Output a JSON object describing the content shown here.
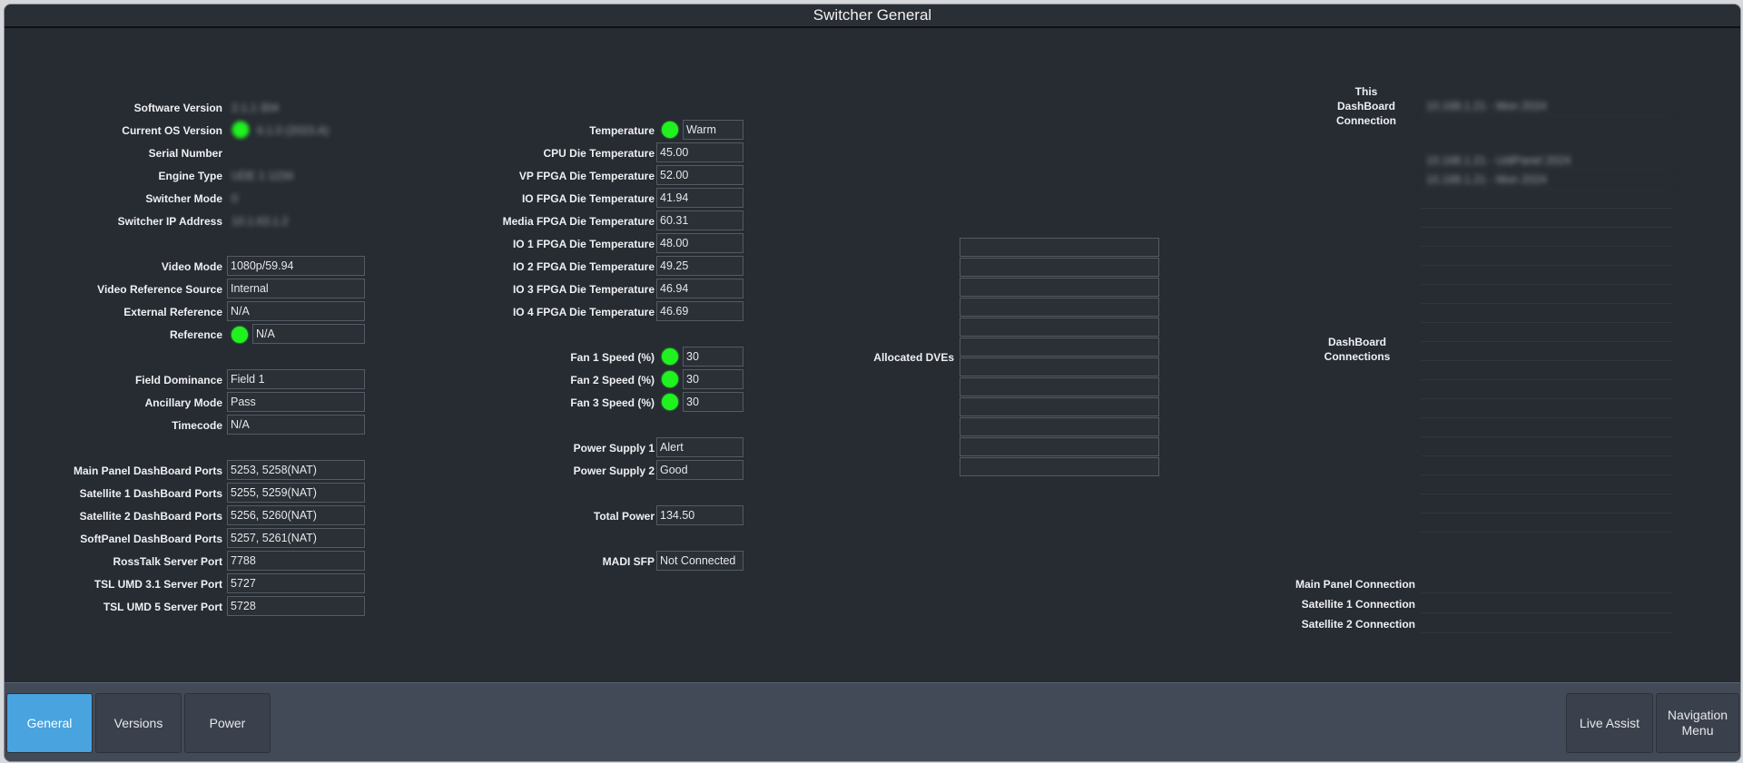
{
  "window": {
    "title": "Switcher General"
  },
  "left": {
    "software_version_label": "Software Version",
    "software_version": "2.1.1 304",
    "current_os_label": "Current OS Version",
    "current_os": "6.1.0 (2023.A)",
    "serial_number_label": "Serial Number",
    "engine_type_label": "Engine Type",
    "engine_type": "UDE 1 1234",
    "switcher_mode_label": "Switcher Mode",
    "switcher_mode": "0",
    "switcher_ip_label": "Switcher IP Address",
    "switcher_ip": "10.1.63.1.2",
    "video_mode_label": "Video Mode",
    "video_mode": "1080p/59.94",
    "video_ref_source_label": "Video Reference Source",
    "video_ref_source": "Internal",
    "external_ref_label": "External Reference",
    "external_ref": "N/A",
    "reference_label": "Reference",
    "reference": "N/A",
    "field_dominance_label": "Field Dominance",
    "field_dominance": "Field 1",
    "ancillary_mode_label": "Ancillary Mode",
    "ancillary_mode": "Pass",
    "timecode_label": "Timecode",
    "timecode": "N/A",
    "main_panel_ports_label": "Main Panel DashBoard Ports",
    "main_panel_ports": "5253, 5258(NAT)",
    "sat1_ports_label": "Satellite 1 DashBoard Ports",
    "sat1_ports": "5255, 5259(NAT)",
    "sat2_ports_label": "Satellite 2 DashBoard Ports",
    "sat2_ports": "5256, 5260(NAT)",
    "softpanel_ports_label": "SoftPanel DashBoard Ports",
    "softpanel_ports": "5257, 5261(NAT)",
    "rosstalk_label": "RossTalk Server Port",
    "rosstalk": "7788",
    "tsl31_label": "TSL UMD 3.1 Server Port",
    "tsl31": "5727",
    "tsl5_label": "TSL UMD 5 Server Port",
    "tsl5": "5728"
  },
  "middle": {
    "temperature_label": "Temperature",
    "temperature": "Warm",
    "cpu_label": "CPU Die Temperature",
    "cpu": "45.00",
    "vp_label": "VP FPGA Die Temperature",
    "vp": "52.00",
    "io_label": "IO FPGA Die Temperature",
    "io": "41.94",
    "media_label": "Media FPGA Die Temperature",
    "media": "60.31",
    "io1_label": "IO 1 FPGA Die Temperature",
    "io1": "48.00",
    "io2_label": "IO 2 FPGA Die Temperature",
    "io2": "49.25",
    "io3_label": "IO 3 FPGA Die Temperature",
    "io3": "46.94",
    "io4_label": "IO 4 FPGA Die Temperature",
    "io4": "46.69",
    "fan1_label": "Fan 1 Speed (%)",
    "fan1": "30",
    "fan2_label": "Fan 2 Speed (%)",
    "fan2": "30",
    "fan3_label": "Fan 3 Speed (%)",
    "fan3": "30",
    "psu1_label": "Power Supply 1",
    "psu1": "Alert",
    "psu2_label": "Power Supply 2",
    "psu2": "Good",
    "total_power_label": "Total Power",
    "total_power": "134.50",
    "madi_label": "MADI SFP",
    "madi": "Not Connected"
  },
  "dves": {
    "label": "Allocated DVEs"
  },
  "right": {
    "this_conn_label": "This DashBoard Connection",
    "this_conn": "10.168.1.21 - Mon 2024",
    "connections_label": "DashBoard Connections",
    "connections": [
      "10.168.1.21 - UdiPanel 2024",
      "10.168.1.21 - Mon 2024"
    ],
    "main_panel_conn_label": "Main Panel Connection",
    "sat1_conn_label": "Satellite 1 Connection",
    "sat2_conn_label": "Satellite 2 Connection"
  },
  "tabs": {
    "general": "General",
    "versions": "Versions",
    "power": "Power",
    "live_assist": "Live Assist",
    "navigation_menu": "Navigation Menu"
  },
  "colors": {
    "accent": "#49a3df",
    "led_ok": "#1ff21f",
    "background": "#272b32"
  }
}
